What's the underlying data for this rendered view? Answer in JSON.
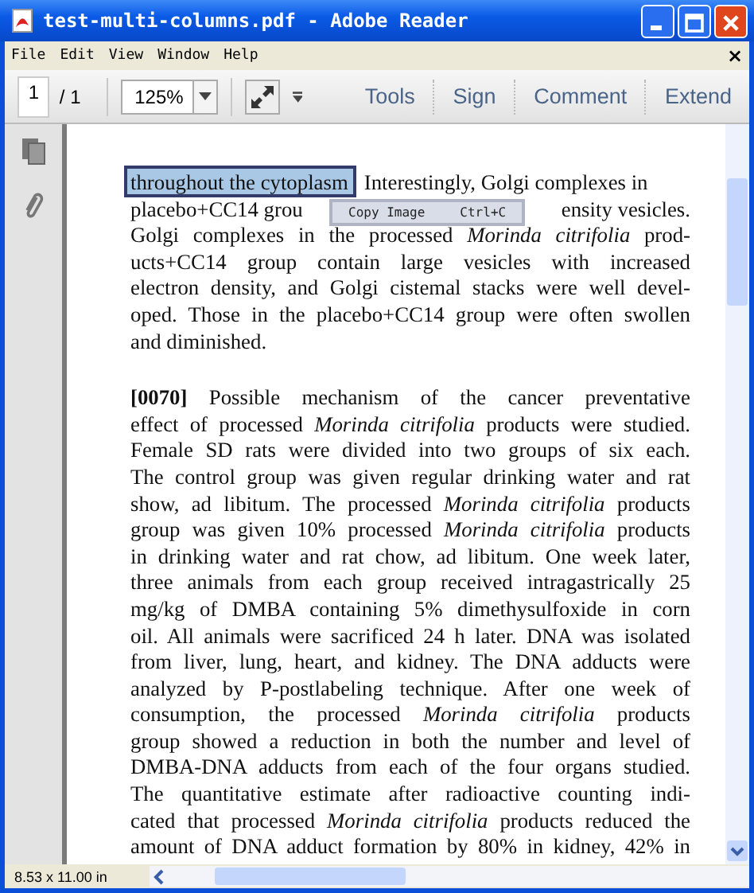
{
  "window": {
    "title": "test-multi-columns.pdf - Adobe Reader"
  },
  "menu": [
    "File",
    "Edit",
    "View",
    "Window",
    "Help"
  ],
  "menu_close": "×",
  "toolbar": {
    "page_number": "1",
    "page_count": "/ 1",
    "zoom": "125%",
    "tabs": [
      "Tools",
      "Sign",
      "Comment",
      "Extend"
    ]
  },
  "document": {
    "paragraphs": [
      {
        "lines": [
          {
            "kind": "selection",
            "selected_text": "throughout the cytoplasm",
            "text": "Interestingly, Golgi complexes in"
          },
          {
            "kind": "covered",
            "left": "placebo+CC14 grou",
            "right": "ensity vesicles."
          },
          {
            "kind": "plain",
            "text": "Golgi complexes in the processed *Morinda citrifolia* prod-"
          },
          {
            "kind": "plain",
            "text": "ucts+CC14 group contain large vesicles with increased"
          },
          {
            "kind": "plain",
            "text": "electron density, and Golgi cistemal stacks were well devel-"
          },
          {
            "kind": "plain",
            "text": "oped. Those in the placebo+CC14 group were often swollen"
          },
          {
            "kind": "end",
            "text": "and diminished."
          }
        ]
      },
      {
        "lines": [
          {
            "kind": "plain",
            "text": "**[0070]**  Possible mechanism of the cancer preventative"
          },
          {
            "kind": "plain",
            "text": "effect of processed *Morinda citrifolia* products were studied."
          },
          {
            "kind": "plain",
            "text": "Female SD rats were divided into two groups of six each."
          },
          {
            "kind": "plain",
            "text": "The control group was given regular drinking water and rat"
          },
          {
            "kind": "plain",
            "text": "show, ad libitum. The processed *Morinda citrifolia* products"
          },
          {
            "kind": "plain",
            "text": "group was given 10% processed *Morinda citrifolia* products"
          },
          {
            "kind": "plain",
            "text": "in drinking water and rat chow, ad libitum. One week later,"
          },
          {
            "kind": "plain",
            "text": "three animals from each group received intragastrically 25"
          },
          {
            "kind": "plain",
            "text": "mg/kg of DMBA containing 5% dimethysulfoxide in corn"
          },
          {
            "kind": "plain",
            "text": "oil. All animals were sacrificed 24 h later. DNA was isolated"
          },
          {
            "kind": "plain",
            "text": "from liver, lung, heart, and kidney. The DNA adducts were"
          },
          {
            "kind": "plain",
            "text": "analyzed by P-postlabeling technique. After one week of"
          },
          {
            "kind": "plain",
            "text": "consumption, the processed *Morinda citrifolia* products"
          },
          {
            "kind": "plain",
            "text": "group showed a reduction in both the number and level of"
          },
          {
            "kind": "plain",
            "text": "DMBA-DNA adducts from each of the four organs studied."
          },
          {
            "kind": "plain",
            "text": "The quantitative estimate after radioactive counting indi-"
          },
          {
            "kind": "plain",
            "text": "cated that processed *Morinda citrifolia* products reduced the"
          },
          {
            "kind": "plain",
            "text": "amount of DNA adduct formation by 80% in kidney, 42% in"
          }
        ]
      }
    ]
  },
  "context_menu": {
    "items": [
      {
        "label": "Copy Image",
        "shortcut": "Ctrl+C"
      }
    ]
  },
  "status_bar": {
    "page_size": "8.53 x 11.00 in"
  }
}
